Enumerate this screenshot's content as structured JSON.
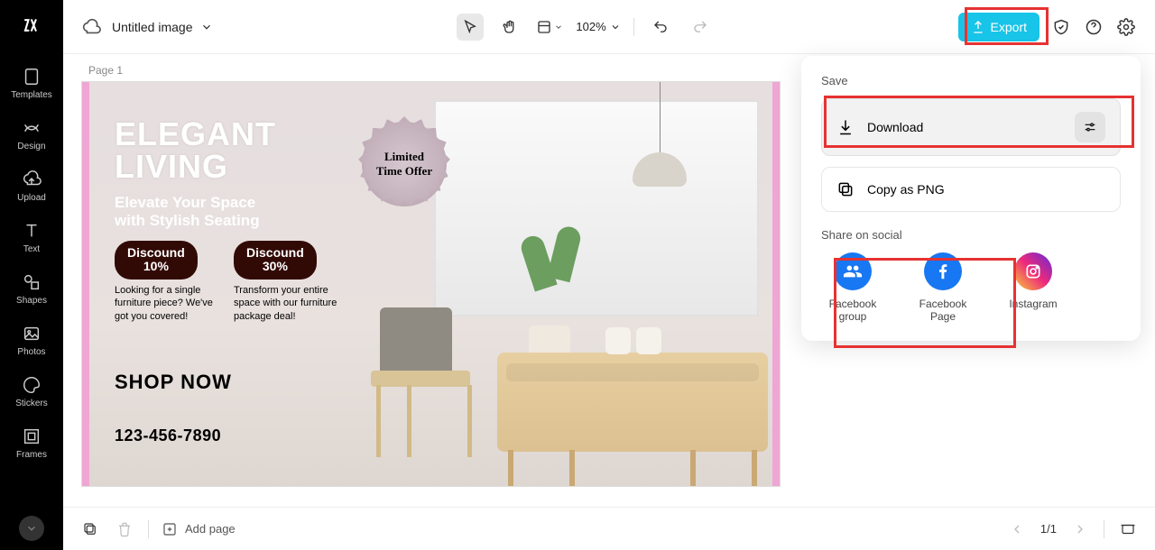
{
  "sidebar": {
    "items": [
      {
        "label": "Templates"
      },
      {
        "label": "Design"
      },
      {
        "label": "Upload"
      },
      {
        "label": "Text"
      },
      {
        "label": "Shapes"
      },
      {
        "label": "Photos"
      },
      {
        "label": "Stickers"
      },
      {
        "label": "Frames"
      }
    ]
  },
  "topbar": {
    "doc_title": "Untitled image",
    "zoom": "102%",
    "export_label": "Export"
  },
  "page": {
    "label": "Page 1"
  },
  "canvas": {
    "heading_line1": "ELEGANT",
    "heading_line2": "LIVING",
    "subtitle_line1": "Elevate Your Space",
    "subtitle_line2": "with Stylish Seating",
    "badge_line1": "Limited",
    "badge_line2": "Time Offer",
    "pill1_line1": "Discound",
    "pill1_line2": "10%",
    "pill2_line1": "Discound",
    "pill2_line2": "30%",
    "desc1": "Looking for a single furniture piece? We've got you covered!",
    "desc2": "Transform your entire space with our furniture package deal!",
    "cta": "SHOP NOW",
    "phone": "123-456-7890"
  },
  "export_panel": {
    "save_label": "Save",
    "download_label": "Download",
    "copy_png_label": "Copy as PNG",
    "share_label": "Share on social",
    "share_items": [
      {
        "label": "Facebook group"
      },
      {
        "label": "Facebook Page"
      },
      {
        "label": "Instagram"
      }
    ]
  },
  "bottom": {
    "add_page": "Add page",
    "page_indicator": "1/1"
  }
}
